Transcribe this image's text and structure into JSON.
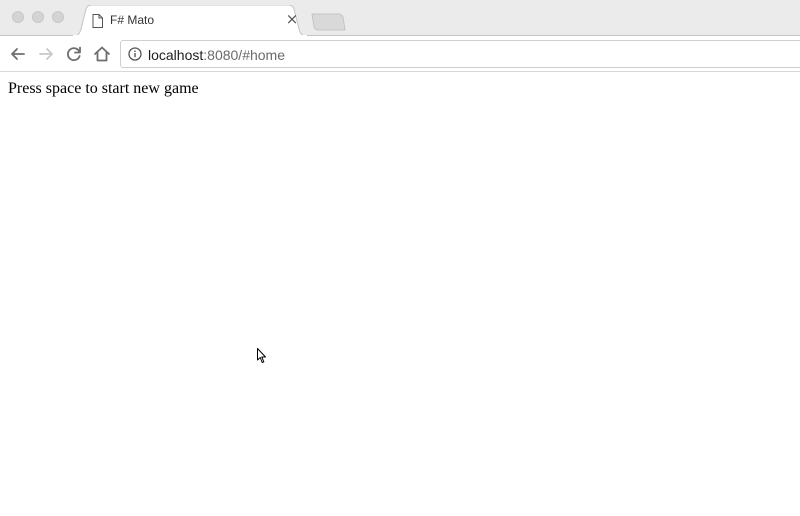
{
  "window": {
    "tab": {
      "title": "F# Mato",
      "close_glyph": "×",
      "icon": "page-icon"
    }
  },
  "toolbar": {
    "back_icon": "arrow-left-icon",
    "forward_icon": "arrow-right-icon",
    "reload_icon": "reload-icon",
    "home_icon": "home-icon",
    "address": {
      "icon": "info-icon",
      "host": "localhost",
      "rest": ":8080/#home"
    }
  },
  "page": {
    "message": "Press space to start new game"
  },
  "colors": {
    "tabstrip": "#ebebeb",
    "tab_active": "#ffffff",
    "newtab": "#d9d9d9",
    "icon_gray": "#6e6e6e",
    "icon_disabled": "#c8c8c8"
  }
}
